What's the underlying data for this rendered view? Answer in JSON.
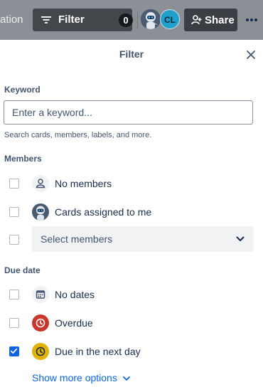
{
  "topbar": {
    "breadcrumb_fragment": "ation",
    "filter_label": "Filter",
    "filter_count": "0",
    "cl_initials": "CL",
    "share_label": "Share"
  },
  "panel": {
    "title": "Filter",
    "keyword": {
      "label": "Keyword",
      "placeholder": "Enter a keyword...",
      "value": "",
      "help": "Search cards, members, labels, and more."
    },
    "members": {
      "label": "Members",
      "items": [
        {
          "label": "No members",
          "checked": false,
          "icon": "person-icon"
        },
        {
          "label": "Cards assigned to me",
          "checked": false,
          "icon": "robot-avatar"
        }
      ],
      "select_label": "Select members"
    },
    "due_date": {
      "label": "Due date",
      "items": [
        {
          "label": "No dates",
          "checked": false,
          "icon": "calendar-icon",
          "color": "#f1f2f4"
        },
        {
          "label": "Overdue",
          "checked": false,
          "icon": "clock-icon",
          "color": "#c9372c"
        },
        {
          "label": "Due in the next day",
          "checked": true,
          "icon": "clock-icon",
          "color": "#e2b203"
        }
      ]
    },
    "show_more": "Show more options"
  },
  "colors": {
    "accent": "#0c66e4",
    "topbar": "#8a9096",
    "overdue": "#c9372c",
    "due_soon": "#e2b203"
  }
}
